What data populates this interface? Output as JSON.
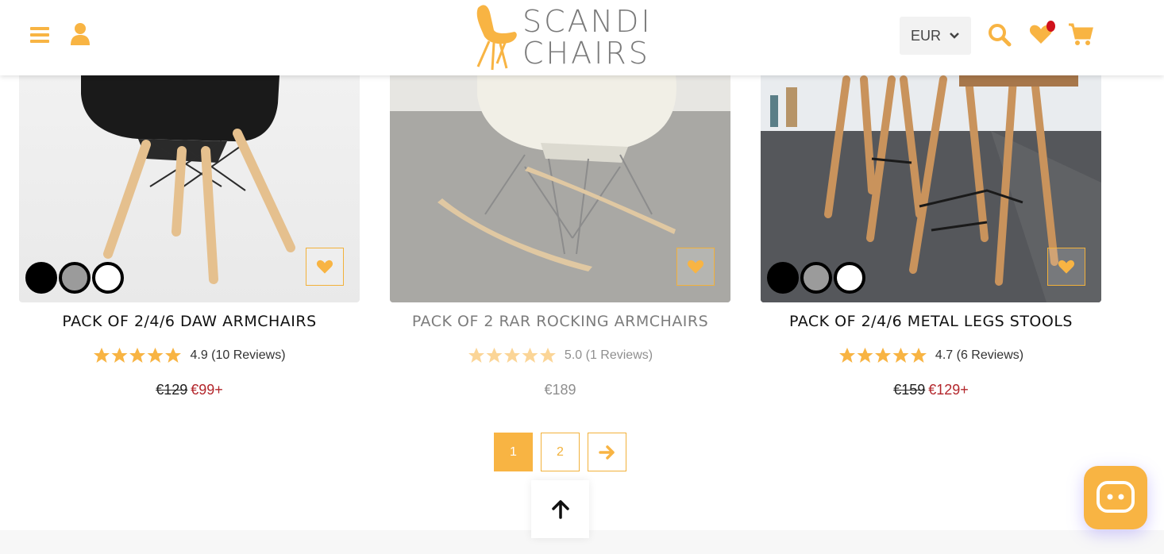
{
  "brand": {
    "accent": "#f8b443",
    "logo_line1": "SCANDI",
    "logo_line2": "CHAIRS"
  },
  "header": {
    "currency": "EUR",
    "icons": [
      "menu-icon",
      "user-icon",
      "search-icon",
      "heart-icon",
      "cart-icon"
    ]
  },
  "products": [
    {
      "title": "PACK OF 2/4/6 DAW ARMCHAIRS",
      "rating": 4.9,
      "reviews_text": "4.9 (10 Reviews)",
      "old_price": "€129",
      "new_price": "€99+",
      "swatches": [
        "#000000",
        "#9b9b9b",
        "#ffffff"
      ]
    },
    {
      "title": "PACK OF 2 RAR ROCKING ARMCHAIRS",
      "rating": 5.0,
      "reviews_text": "5.0 (1 Reviews)",
      "price": "€189"
    },
    {
      "title": "PACK OF 2/4/6 METAL LEGS STOOLS",
      "rating": 4.7,
      "reviews_text": "4.7 (6 Reviews)",
      "old_price": "€159",
      "new_price": "€129+",
      "swatches": [
        "#000000",
        "#9b9b9b",
        "#ffffff"
      ]
    }
  ],
  "pagination": {
    "pages": [
      "1",
      "2"
    ],
    "current": "1"
  }
}
